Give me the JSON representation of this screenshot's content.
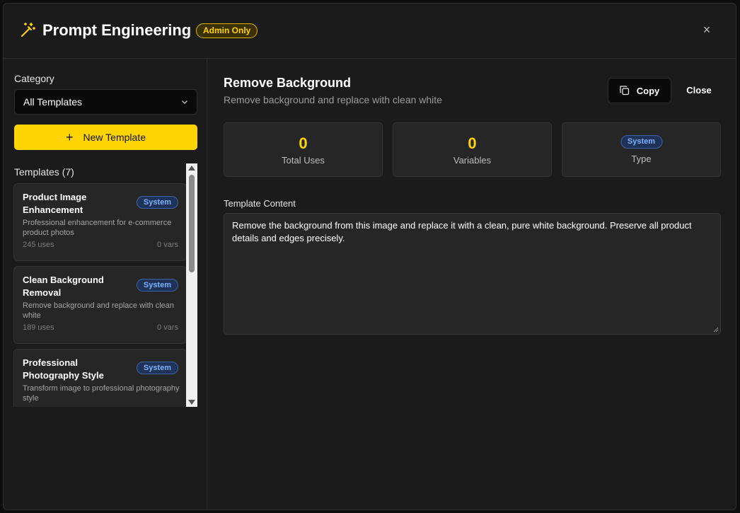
{
  "header": {
    "title": "Prompt Engineering",
    "badge": "Admin Only",
    "close_symbol": "×",
    "accent": "#ffd400"
  },
  "sidebar": {
    "category_label": "Category",
    "category_value": "All Templates",
    "new_template_label": "New Template",
    "templates_heading": "Templates (7)",
    "templates": [
      {
        "name": "Product Image Enhancement",
        "badge": "System",
        "description": "Professional enhancement for e-commerce product photos",
        "uses": "245 uses",
        "vars": "0 vars"
      },
      {
        "name": "Clean Background Removal",
        "badge": "System",
        "description": "Remove background and replace with clean white",
        "uses": "189 uses",
        "vars": "0 vars"
      },
      {
        "name": "Professional Photography Style",
        "badge": "System",
        "description": "Transform image to professional photography style",
        "uses": "",
        "vars": ""
      }
    ]
  },
  "detail": {
    "title": "Remove Background",
    "subtitle": "Remove background and replace with clean white",
    "copy_label": "Copy",
    "close_label": "Close",
    "stats": {
      "total_uses_value": "0",
      "total_uses_label": "Total Uses",
      "variables_value": "0",
      "variables_label": "Variables",
      "type_badge": "System",
      "type_label": "Type"
    },
    "content_label": "Template Content",
    "content": "Remove the background from this image and replace it with a clean, pure white background. Preserve all product details and edges precisely."
  }
}
